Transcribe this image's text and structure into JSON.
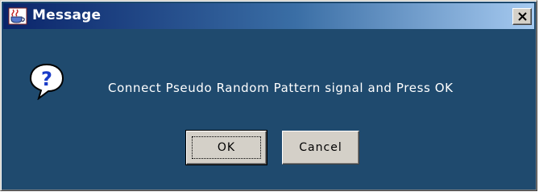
{
  "window": {
    "title": "Message",
    "app_icon": "java-cup-icon",
    "close_icon": "close-icon"
  },
  "dialog": {
    "icon": "question-icon",
    "message": "Connect Pseudo Random Pattern signal and Press OK",
    "buttons": {
      "ok_label": "OK",
      "cancel_label": "Cancel"
    }
  },
  "colors": {
    "background": "#1f4a6e",
    "title_start": "#0a246a",
    "title_end": "#a6caf0",
    "button_face": "#d4d0c8"
  }
}
